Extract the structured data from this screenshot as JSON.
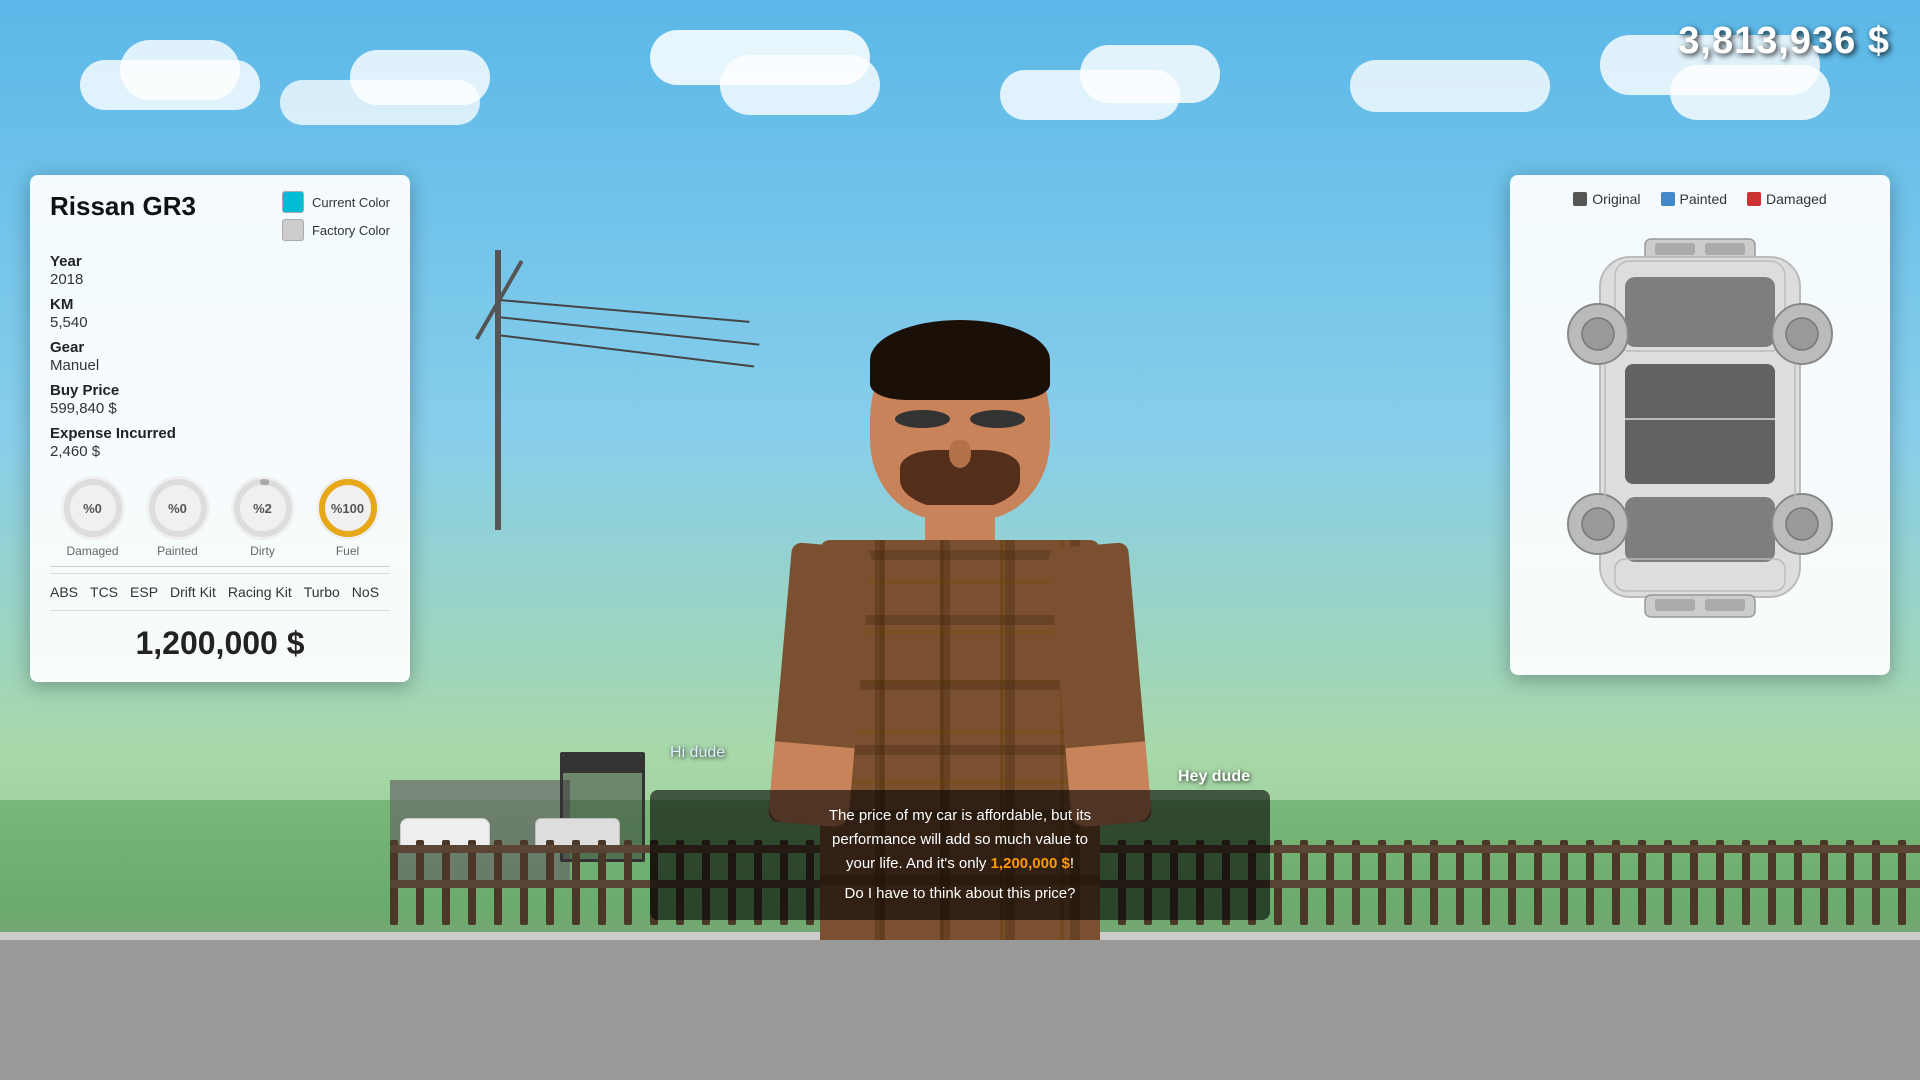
{
  "hud": {
    "money": "3,813,936 $"
  },
  "car_panel": {
    "title": "Rissan GR3",
    "current_color_label": "Current Color",
    "current_color": "#00bcd4",
    "factory_color_label": "Factory Color",
    "factory_color": "#cccccc",
    "year_label": "Year",
    "year_value": "2018",
    "km_label": "KM",
    "km_value": "5,540",
    "gear_label": "Gear",
    "gear_value": "Manuel",
    "buy_price_label": "Buy Price",
    "buy_price_value": "599,840 $",
    "expense_label": "Expense Incurred",
    "expense_value": "2,460 $",
    "gauges": [
      {
        "id": "damaged",
        "label": "Damaged",
        "percent": 0,
        "text": "%0",
        "color": "#aaa",
        "bg": "#ddd",
        "filled": 0
      },
      {
        "id": "painted",
        "label": "Painted",
        "percent": 0,
        "text": "%0",
        "color": "#aaa",
        "bg": "#ddd",
        "filled": 0
      },
      {
        "id": "dirty",
        "label": "Dirty",
        "percent": 2,
        "text": "%2",
        "color": "#aaa",
        "bg": "#ddd",
        "filled": 0.02
      },
      {
        "id": "fuel",
        "label": "Fuel",
        "percent": 100,
        "text": "%100",
        "color": "#e6a817",
        "bg": "#f0d080",
        "filled": 1.0
      }
    ],
    "features": [
      "ABS",
      "TCS",
      "ESP",
      "Drift Kit",
      "Racing Kit",
      "Turbo",
      "NoS"
    ],
    "sale_price": "1,200,000 $"
  },
  "diagram_panel": {
    "legend": [
      {
        "label": "Original",
        "color": "#555"
      },
      {
        "label": "Painted",
        "color": "#4488cc"
      },
      {
        "label": "Damaged",
        "color": "#cc3333"
      }
    ]
  },
  "dialog": {
    "speaker_player": "Hi dude",
    "speaker_npc": "Hey dude",
    "line1": "The price of my car is affordable, but its",
    "line2": "performance will add so much value to",
    "line3": "your life. And it's only",
    "price_highlight": "1,200,000 $",
    "line4": "!",
    "question": "Do I have to think about this price?"
  }
}
